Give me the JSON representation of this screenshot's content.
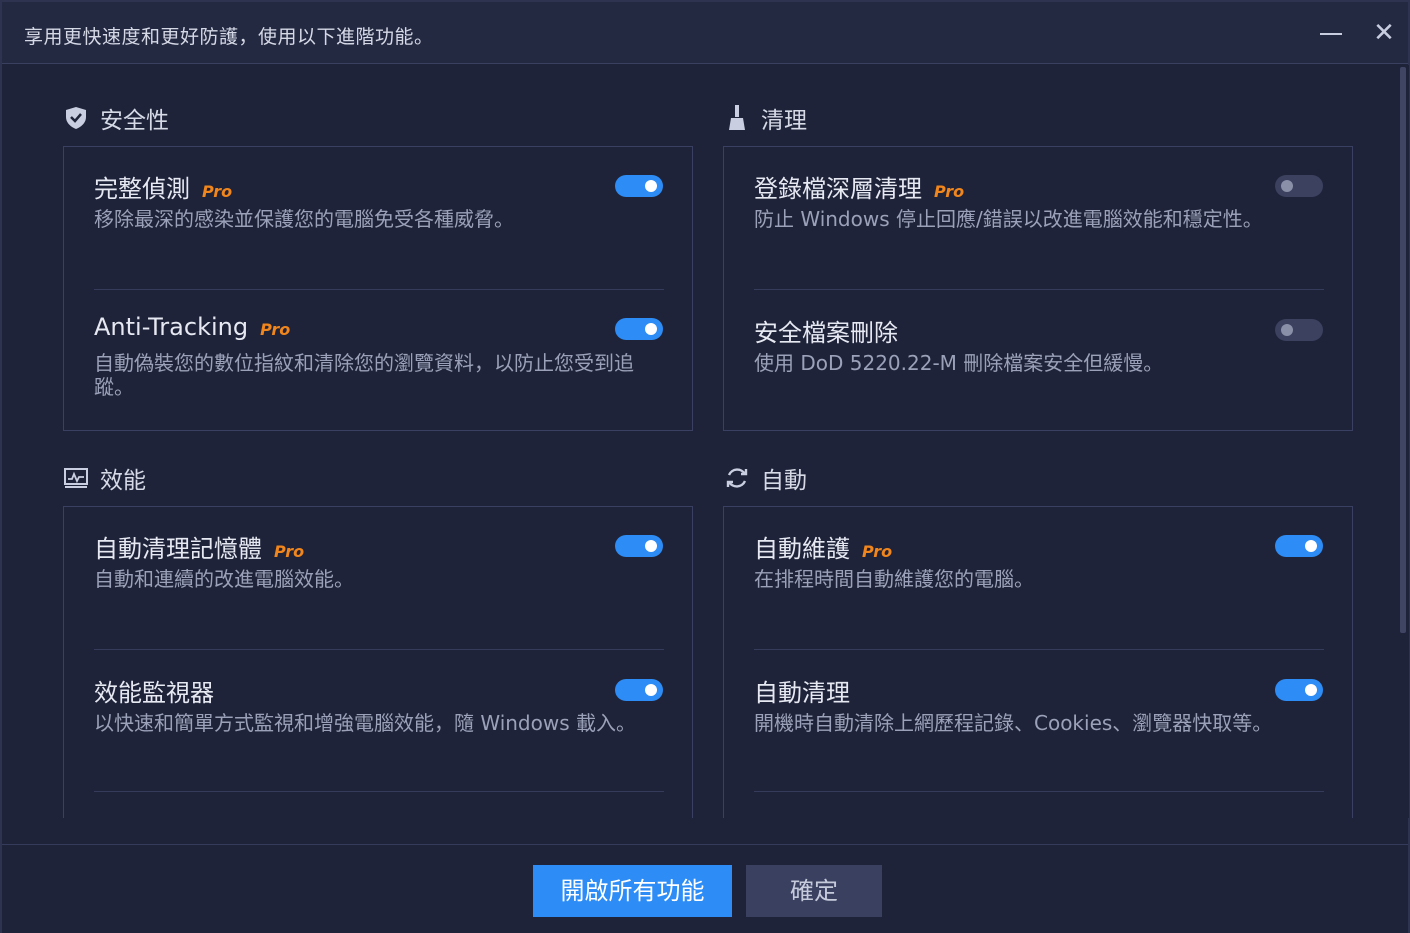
{
  "window": {
    "title": "享用更快速度和更好防護，使用以下進階功能。",
    "minimize_glyph": "—",
    "close_glyph": "✕"
  },
  "pro_badge": "Pro",
  "sections": {
    "security": {
      "title": "安全性",
      "icon": "shield-icon",
      "items": [
        {
          "name": "完整偵測",
          "pro": true,
          "desc": "移除最深的感染並保護您的電腦免受各種威脅。",
          "enabled": true
        },
        {
          "name": "Anti-Tracking",
          "pro": true,
          "desc": "自動偽裝您的數位指紋和清除您的瀏覽資料，以防止您受到追蹤。",
          "enabled": true
        }
      ]
    },
    "clean": {
      "title": "清理",
      "icon": "broom-icon",
      "items": [
        {
          "name": "登錄檔深層清理",
          "pro": true,
          "desc": "防止 Windows 停止回應/錯誤以改進電腦效能和穩定性。",
          "enabled": false
        },
        {
          "name": "安全檔案刪除",
          "pro": false,
          "desc": "使用 DoD 5220.22-M 刪除檔案安全但緩慢。",
          "enabled": false
        }
      ]
    },
    "performance": {
      "title": "效能",
      "icon": "monitor-chart-icon",
      "items": [
        {
          "name": "自動清理記憶體",
          "pro": true,
          "desc": "自動和連續的改進電腦效能。",
          "enabled": true
        },
        {
          "name": "效能監視器",
          "pro": false,
          "desc": "以快速和簡單方式監視和增強電腦效能，隨 Windows 載入。",
          "enabled": true
        }
      ]
    },
    "auto": {
      "title": "自動",
      "icon": "refresh-icon",
      "items": [
        {
          "name": "自動維護",
          "pro": true,
          "desc": "在排程時間自動維護您的電腦。",
          "enabled": true
        },
        {
          "name": "自動清理",
          "pro": false,
          "desc": "開機時自動清除上網歷程記錄、Cookies、瀏覽器快取等。",
          "enabled": true
        }
      ]
    }
  },
  "footer": {
    "enable_all_label": "開啟所有功能",
    "ok_label": "確定"
  },
  "colors": {
    "background": "#1f2339",
    "accent": "#2d8cf5",
    "pro_badge": "#f0861c"
  }
}
